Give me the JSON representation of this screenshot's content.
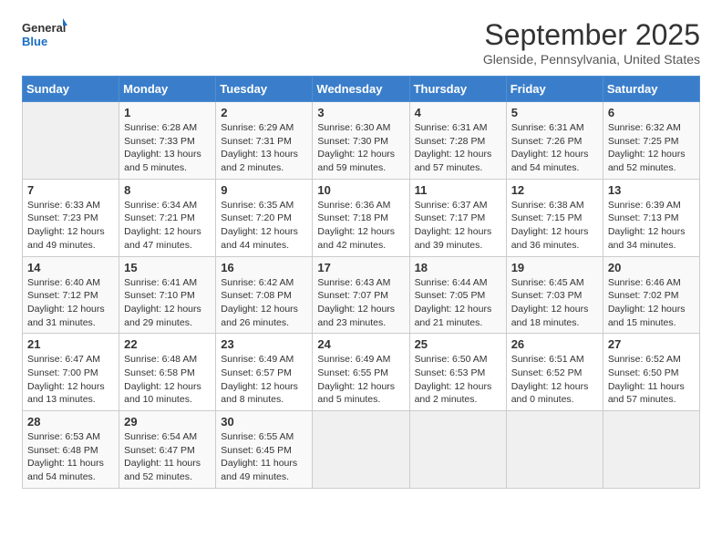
{
  "logo": {
    "line1": "General",
    "line2": "Blue"
  },
  "title": "September 2025",
  "subtitle": "Glenside, Pennsylvania, United States",
  "weekdays": [
    "Sunday",
    "Monday",
    "Tuesday",
    "Wednesday",
    "Thursday",
    "Friday",
    "Saturday"
  ],
  "weeks": [
    [
      {
        "day": "",
        "info": ""
      },
      {
        "day": "1",
        "info": "Sunrise: 6:28 AM\nSunset: 7:33 PM\nDaylight: 13 hours\nand 5 minutes."
      },
      {
        "day": "2",
        "info": "Sunrise: 6:29 AM\nSunset: 7:31 PM\nDaylight: 13 hours\nand 2 minutes."
      },
      {
        "day": "3",
        "info": "Sunrise: 6:30 AM\nSunset: 7:30 PM\nDaylight: 12 hours\nand 59 minutes."
      },
      {
        "day": "4",
        "info": "Sunrise: 6:31 AM\nSunset: 7:28 PM\nDaylight: 12 hours\nand 57 minutes."
      },
      {
        "day": "5",
        "info": "Sunrise: 6:31 AM\nSunset: 7:26 PM\nDaylight: 12 hours\nand 54 minutes."
      },
      {
        "day": "6",
        "info": "Sunrise: 6:32 AM\nSunset: 7:25 PM\nDaylight: 12 hours\nand 52 minutes."
      }
    ],
    [
      {
        "day": "7",
        "info": "Sunrise: 6:33 AM\nSunset: 7:23 PM\nDaylight: 12 hours\nand 49 minutes."
      },
      {
        "day": "8",
        "info": "Sunrise: 6:34 AM\nSunset: 7:21 PM\nDaylight: 12 hours\nand 47 minutes."
      },
      {
        "day": "9",
        "info": "Sunrise: 6:35 AM\nSunset: 7:20 PM\nDaylight: 12 hours\nand 44 minutes."
      },
      {
        "day": "10",
        "info": "Sunrise: 6:36 AM\nSunset: 7:18 PM\nDaylight: 12 hours\nand 42 minutes."
      },
      {
        "day": "11",
        "info": "Sunrise: 6:37 AM\nSunset: 7:17 PM\nDaylight: 12 hours\nand 39 minutes."
      },
      {
        "day": "12",
        "info": "Sunrise: 6:38 AM\nSunset: 7:15 PM\nDaylight: 12 hours\nand 36 minutes."
      },
      {
        "day": "13",
        "info": "Sunrise: 6:39 AM\nSunset: 7:13 PM\nDaylight: 12 hours\nand 34 minutes."
      }
    ],
    [
      {
        "day": "14",
        "info": "Sunrise: 6:40 AM\nSunset: 7:12 PM\nDaylight: 12 hours\nand 31 minutes."
      },
      {
        "day": "15",
        "info": "Sunrise: 6:41 AM\nSunset: 7:10 PM\nDaylight: 12 hours\nand 29 minutes."
      },
      {
        "day": "16",
        "info": "Sunrise: 6:42 AM\nSunset: 7:08 PM\nDaylight: 12 hours\nand 26 minutes."
      },
      {
        "day": "17",
        "info": "Sunrise: 6:43 AM\nSunset: 7:07 PM\nDaylight: 12 hours\nand 23 minutes."
      },
      {
        "day": "18",
        "info": "Sunrise: 6:44 AM\nSunset: 7:05 PM\nDaylight: 12 hours\nand 21 minutes."
      },
      {
        "day": "19",
        "info": "Sunrise: 6:45 AM\nSunset: 7:03 PM\nDaylight: 12 hours\nand 18 minutes."
      },
      {
        "day": "20",
        "info": "Sunrise: 6:46 AM\nSunset: 7:02 PM\nDaylight: 12 hours\nand 15 minutes."
      }
    ],
    [
      {
        "day": "21",
        "info": "Sunrise: 6:47 AM\nSunset: 7:00 PM\nDaylight: 12 hours\nand 13 minutes."
      },
      {
        "day": "22",
        "info": "Sunrise: 6:48 AM\nSunset: 6:58 PM\nDaylight: 12 hours\nand 10 minutes."
      },
      {
        "day": "23",
        "info": "Sunrise: 6:49 AM\nSunset: 6:57 PM\nDaylight: 12 hours\nand 8 minutes."
      },
      {
        "day": "24",
        "info": "Sunrise: 6:49 AM\nSunset: 6:55 PM\nDaylight: 12 hours\nand 5 minutes."
      },
      {
        "day": "25",
        "info": "Sunrise: 6:50 AM\nSunset: 6:53 PM\nDaylight: 12 hours\nand 2 minutes."
      },
      {
        "day": "26",
        "info": "Sunrise: 6:51 AM\nSunset: 6:52 PM\nDaylight: 12 hours\nand 0 minutes."
      },
      {
        "day": "27",
        "info": "Sunrise: 6:52 AM\nSunset: 6:50 PM\nDaylight: 11 hours\nand 57 minutes."
      }
    ],
    [
      {
        "day": "28",
        "info": "Sunrise: 6:53 AM\nSunset: 6:48 PM\nDaylight: 11 hours\nand 54 minutes."
      },
      {
        "day": "29",
        "info": "Sunrise: 6:54 AM\nSunset: 6:47 PM\nDaylight: 11 hours\nand 52 minutes."
      },
      {
        "day": "30",
        "info": "Sunrise: 6:55 AM\nSunset: 6:45 PM\nDaylight: 11 hours\nand 49 minutes."
      },
      {
        "day": "",
        "info": ""
      },
      {
        "day": "",
        "info": ""
      },
      {
        "day": "",
        "info": ""
      },
      {
        "day": "",
        "info": ""
      }
    ]
  ]
}
